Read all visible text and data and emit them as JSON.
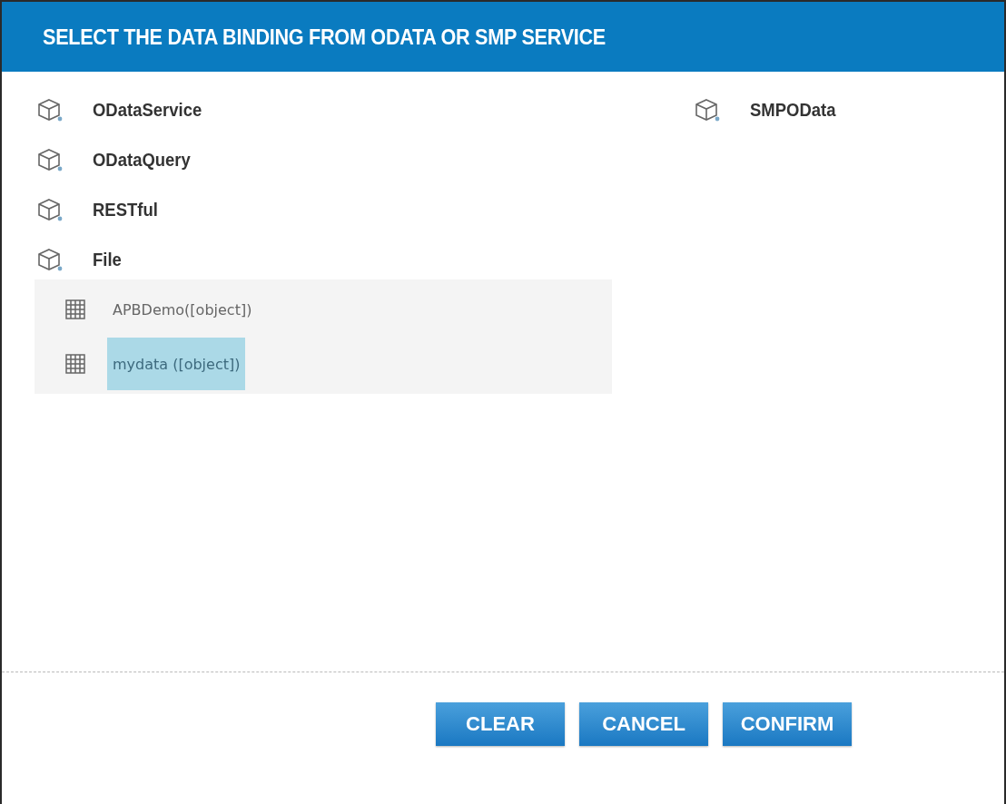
{
  "dialog": {
    "title": "SELECT THE DATA BINDING FROM ODATA OR SMP SERVICE"
  },
  "columns": [
    {
      "sources": [
        {
          "name": "ODataService"
        },
        {
          "name": "ODataQuery"
        },
        {
          "name": "RESTful"
        },
        {
          "name": "File",
          "children": [
            {
              "label": "APBDemo([object])",
              "selected": false
            },
            {
              "label": "mydata ([object])",
              "selected": true
            }
          ]
        }
      ]
    },
    {
      "sources": [
        {
          "name": "SMPOData"
        }
      ]
    }
  ],
  "buttons": [
    {
      "label": "CLEAR"
    },
    {
      "label": "CANCEL"
    },
    {
      "label": "CONFIRM"
    }
  ]
}
